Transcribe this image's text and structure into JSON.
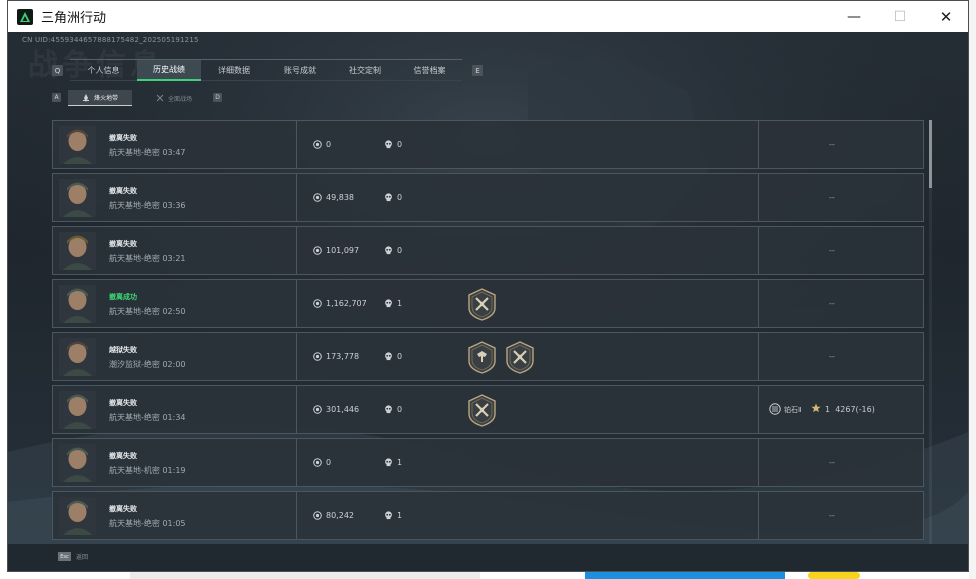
{
  "window": {
    "title": "三角洲行动",
    "minimize": "—",
    "maximize": "☐",
    "close": "✕"
  },
  "uid": "CN UID:4559344657888175482_202505191215",
  "page_title": "战争信息",
  "nav_keys": {
    "left": "Q",
    "right": "E",
    "sub_left": "A",
    "sub_right": "D"
  },
  "tabs": [
    {
      "label": "个人信息",
      "active": false
    },
    {
      "label": "历史战绩",
      "active": true
    },
    {
      "label": "详细数据",
      "active": false
    },
    {
      "label": "账号成就",
      "active": false
    },
    {
      "label": "社交定制",
      "active": false
    },
    {
      "label": "信誉档案",
      "active": false
    }
  ],
  "subtabs": [
    {
      "label": "烽火地带",
      "active": true,
      "icon": "flame-icon"
    },
    {
      "label": "全面战场",
      "active": false,
      "icon": "swords-icon"
    }
  ],
  "matches": [
    {
      "result": "撤离失败",
      "success": false,
      "map": "航天基地-绝密",
      "time": "03:47",
      "value": "0",
      "kills": "0",
      "badges": [],
      "rank": null
    },
    {
      "result": "撤离失败",
      "success": false,
      "map": "航天基地-绝密",
      "time": "03:36",
      "value": "49,838",
      "kills": "0",
      "badges": [],
      "rank": null
    },
    {
      "result": "撤离失败",
      "success": false,
      "map": "航天基地-绝密",
      "time": "03:21",
      "value": "101,097",
      "kills": "0",
      "badges": [],
      "rank": null
    },
    {
      "result": "撤离成功",
      "success": true,
      "map": "航天基地-绝密",
      "time": "02:50",
      "value": "1,162,707",
      "kills": "1",
      "badges": [
        "crossed-rifles-badge"
      ],
      "rank": null
    },
    {
      "result": "越狱失败",
      "success": false,
      "map": "潮汐监狱-绝密",
      "time": "02:00",
      "value": "173,778",
      "kills": "0",
      "badges": [
        "eagle-badge",
        "crossed-rifles-badge"
      ],
      "rank": null
    },
    {
      "result": "撤离失败",
      "success": false,
      "map": "航天基地-绝密",
      "time": "01:34",
      "value": "301,446",
      "kills": "0",
      "badges": [
        "crossed-rifles-badge"
      ],
      "rank": {
        "tier": "铂石Ⅱ",
        "stars": "1",
        "score": "4267(-16)"
      }
    },
    {
      "result": "撤离失败",
      "success": false,
      "map": "航天基地-机密",
      "time": "01:19",
      "value": "0",
      "kills": "1",
      "badges": [],
      "rank": null
    },
    {
      "result": "撤离失败",
      "success": false,
      "map": "航天基地-绝密",
      "time": "01:05",
      "value": "80,242",
      "kills": "1",
      "badges": [],
      "rank": null
    }
  ],
  "empty_rank": "--",
  "footer": {
    "esc_key": "Esc",
    "esc_label": "返回"
  },
  "colors": {
    "accent_green": "#3fd07a",
    "success_text": "#3ed776",
    "panel": "#2a323a"
  }
}
